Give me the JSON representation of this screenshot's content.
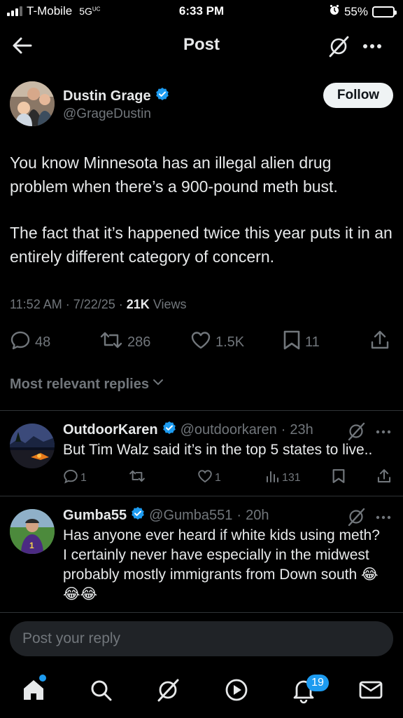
{
  "status_bar": {
    "carrier": "T-Mobile",
    "network": "5G",
    "network_sub": "UC",
    "time": "6:33 PM",
    "battery": "55%",
    "battery_level": 0.55
  },
  "nav": {
    "title": "Post"
  },
  "post": {
    "author_name": "Dustin Grage",
    "author_handle": "@GrageDustin",
    "follow_label": "Follow",
    "paragraphs": [
      "You know Minnesota has an illegal alien drug problem when there’s a 900-pound meth bust.",
      "The fact that it’s happened twice this year puts it in an entirely different category of concern."
    ],
    "time": "11:52 AM",
    "date": "7/22/25",
    "views_count": "21K",
    "views_label": "Views",
    "stats": {
      "replies": "48",
      "reposts": "286",
      "likes": "1.5K",
      "bookmarks": "11"
    }
  },
  "replies_filter": {
    "label": "Most relevant replies"
  },
  "replies": [
    {
      "name": "OutdoorKaren",
      "handle": "@outdoorkaren",
      "time": "23h",
      "text": "But Tim Walz said it’s in the top 5 states to live..",
      "stats": {
        "replies": "1",
        "reposts": "",
        "likes": "1",
        "views": "131"
      }
    },
    {
      "name": "Gumba55",
      "handle": "@Gumba551",
      "time": "20h",
      "text": "Has anyone ever heard if white kids using meth? I certainly never have especially in the midwest probably mostly immigrants from Down south 😂😂😂"
    }
  ],
  "composer": {
    "placeholder": "Post your reply"
  },
  "tabbar": {
    "notifications_badge": "19"
  },
  "colors": {
    "background": "#000000",
    "accent": "#1d9bf0",
    "secondary_text": "#71767b",
    "divider": "#2f3336"
  }
}
